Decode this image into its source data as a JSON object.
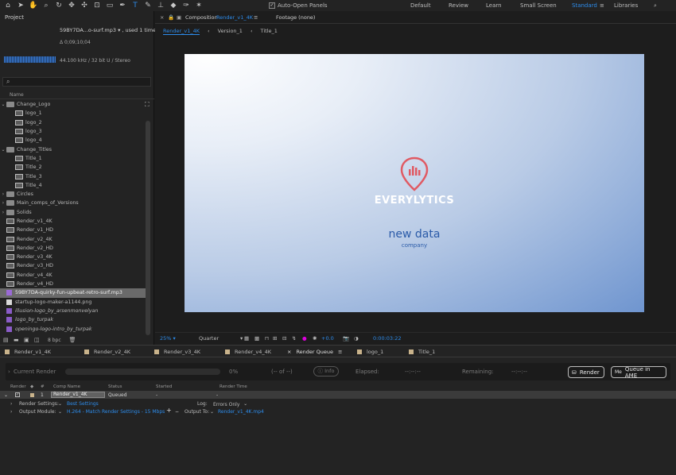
{
  "toolbar": {
    "tools": [
      "home-icon",
      "select-arrow-icon",
      "hand-icon",
      "zoom-icon",
      "rotate-icon",
      "orbit-icon",
      "pan-behind-icon",
      "camera-icon",
      "rect-mask-icon",
      "pen-icon",
      "type-icon",
      "brush-icon",
      "clone-stamp-icon",
      "eraser-icon",
      "roto-brush-icon",
      "puppet-icon"
    ],
    "auto_open_label": "Auto-Open Panels",
    "workspaces": [
      "Default",
      "Review",
      "Learn",
      "Small Screen",
      "Standard",
      "Libraries"
    ],
    "active_workspace": "Standard"
  },
  "project": {
    "tab_label": "Project",
    "selected_name": "59BY7DA...o-surf.mp3 ▾ , used 1 time",
    "duration": "Δ 0;09;10;04",
    "audio_info": "44.100 kHz / 32 bit U / Stereo",
    "search_placeholder": "",
    "column_name": "Name",
    "bpc": "8 bpc",
    "items": [
      {
        "label": "Change_Logo",
        "kind": "folder",
        "depth": 0,
        "open": true
      },
      {
        "label": "logo_1",
        "kind": "comp",
        "depth": 1
      },
      {
        "label": "logo_2",
        "kind": "comp",
        "depth": 1
      },
      {
        "label": "logo_3",
        "kind": "comp",
        "depth": 1
      },
      {
        "label": "logo_4",
        "kind": "comp",
        "depth": 1
      },
      {
        "label": "Change_Titles",
        "kind": "folder",
        "depth": 0,
        "open": true
      },
      {
        "label": "Title_1",
        "kind": "comp",
        "depth": 1
      },
      {
        "label": "Title_2",
        "kind": "comp",
        "depth": 1
      },
      {
        "label": "Title_3",
        "kind": "comp",
        "depth": 1
      },
      {
        "label": "Title_4",
        "kind": "comp",
        "depth": 1
      },
      {
        "label": "Circles",
        "kind": "folder",
        "depth": 0
      },
      {
        "label": "Main_comps_of_Versions",
        "kind": "folder",
        "depth": 0
      },
      {
        "label": "Solids",
        "kind": "folder",
        "depth": 0
      },
      {
        "label": "Render_v1_4K",
        "kind": "comp",
        "depth": 0
      },
      {
        "label": "Render_v1_HD",
        "kind": "comp",
        "depth": 0
      },
      {
        "label": "Render_v2_4K",
        "kind": "comp",
        "depth": 0
      },
      {
        "label": "Render_v2_HD",
        "kind": "comp",
        "depth": 0
      },
      {
        "label": "Render_v3_4K",
        "kind": "comp",
        "depth": 0
      },
      {
        "label": "Render_v3_HD",
        "kind": "comp",
        "depth": 0
      },
      {
        "label": "Render_v4_4K",
        "kind": "comp",
        "depth": 0
      },
      {
        "label": "Render_v4_HD",
        "kind": "comp",
        "depth": 0
      },
      {
        "label": "59BY7DA-quirky-fun-upbeat-retro-surf.mp3",
        "kind": "audio",
        "depth": 0,
        "selected": true
      },
      {
        "label": "startup-logo-maker-a1144.png",
        "kind": "file",
        "depth": 0
      },
      {
        "label": "illusion-logo_by_arsenmonvelyan",
        "kind": "aep",
        "depth": 0
      },
      {
        "label": "logo_by_turpak",
        "kind": "aep",
        "depth": 0
      },
      {
        "label": "openingo-logo-intro_by_turpak",
        "kind": "aep",
        "depth": 0
      }
    ]
  },
  "viewer": {
    "tab_prefix": "Composition",
    "tab_comp": "Render_v1_4K",
    "footage_tab": "Footage (none)",
    "breadcrumbs": [
      "Render_v1_4K",
      "Version_1",
      "Title_1"
    ],
    "brand_text": "EVERYLYTICS",
    "headline": "new data",
    "subline": "company",
    "zoom": "25%",
    "resolution": "Quarter",
    "exposure": "+0.0",
    "timecode": "0:00:03:22",
    "colors": {
      "accent": "#2d8ceb",
      "logo": "#e05a63",
      "headline": "#2a5aa8"
    }
  },
  "bottom": {
    "tabs": [
      "Render_v1_4K",
      "Render_v2_4K",
      "Render_v3_4K",
      "Render_v4_4K",
      "Render Queue",
      "logo_1",
      "Title_1"
    ],
    "active_tab": "Render Queue",
    "current_render_label": "Current Render",
    "percent": "0%",
    "of_label": "(-- of --)",
    "info_label": "Info",
    "elapsed_label": "Elapsed:",
    "elapsed_value": "--:--:--",
    "remaining_label": "Remaining:",
    "remaining_value": "--:--:--",
    "render_button": "Render",
    "queue_ame_button": "Queue in AME",
    "columns": [
      "Render",
      "#",
      "Comp Name",
      "Status",
      "Started",
      "Render Time"
    ],
    "queue_item": {
      "index": "1",
      "comp": "Render_v1_4K",
      "status": "Queued",
      "started": "-",
      "render_time": "-"
    },
    "render_settings_label": "Render Settings:",
    "render_settings_value": "Best Settings",
    "log_label": "Log:",
    "log_value": "Errors Only",
    "output_module_label": "Output Module:",
    "output_module_value": "H.264 - Match Render Settings - 15 Mbps",
    "output_to_label": "Output To:",
    "output_to_value": "Render_v1_4K.mp4"
  }
}
